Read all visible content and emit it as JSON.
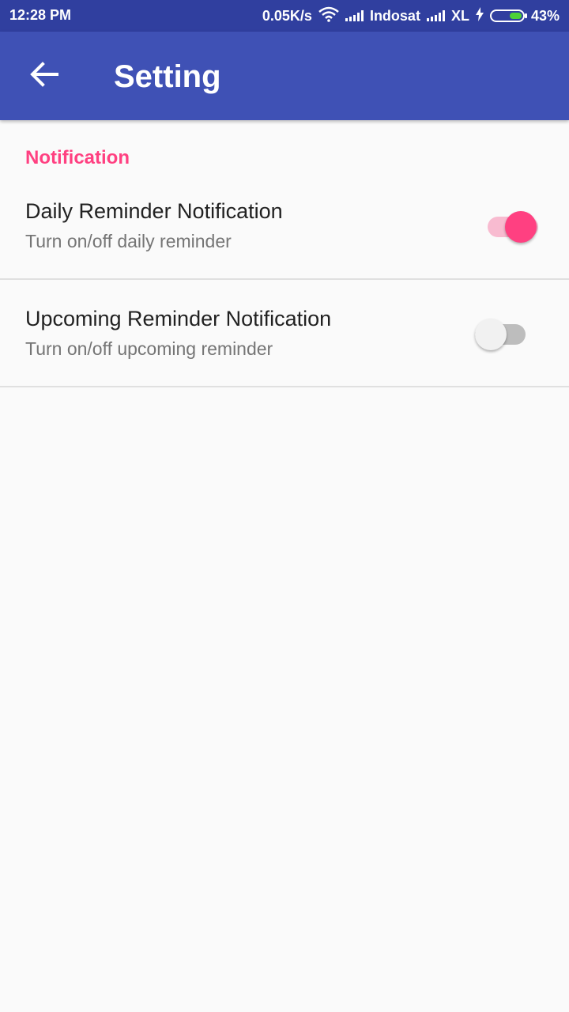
{
  "status_bar": {
    "time": "12:28 PM",
    "net_speed": "0.05K/s",
    "carrier1": "Indosat",
    "carrier2": "XL",
    "battery": "43%",
    "battery_level": 0.43,
    "icons": [
      "wifi-icon",
      "signal-icon",
      "signal-icon",
      "charging-icon",
      "battery-icon"
    ]
  },
  "app_bar": {
    "title": "Setting",
    "back_icon": "arrow-back-icon",
    "color": "#3f51b5"
  },
  "section": {
    "header": "Notification",
    "color": "#ff4081"
  },
  "preferences": [
    {
      "title": "Daily Reminder Notification",
      "summary": "Turn on/off daily reminder",
      "enabled": true
    },
    {
      "title": "Upcoming Reminder Notification",
      "summary": "Turn on/off upcoming reminder",
      "enabled": false
    }
  ]
}
